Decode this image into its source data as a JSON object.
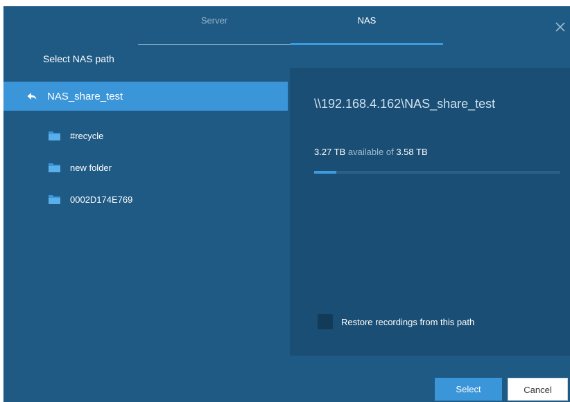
{
  "tabs": [
    {
      "label": "Server"
    },
    {
      "label": "NAS"
    }
  ],
  "left": {
    "title": "Select NAS path",
    "current": "NAS_share_test",
    "folders": [
      {
        "label": "#recycle"
      },
      {
        "label": "new folder"
      },
      {
        "label": "0002D174E769"
      }
    ]
  },
  "right": {
    "path": "\\\\192.168.4.162\\NAS_share_test",
    "available": "3.27 TB",
    "available_of_text": "available of",
    "total": "3.58 TB",
    "used_fraction": 0.09,
    "restore_label": "Restore recordings from this path",
    "restore_checked": false
  },
  "buttons": {
    "select": "Select",
    "cancel": "Cancel"
  },
  "colors": {
    "dialog_bg": "#1f5a84",
    "panel_bg": "#1a4e74",
    "accent": "#3b95d9"
  },
  "icons": {
    "close": "close-icon",
    "back": "back-arrow-icon",
    "folder": "folder-icon"
  }
}
